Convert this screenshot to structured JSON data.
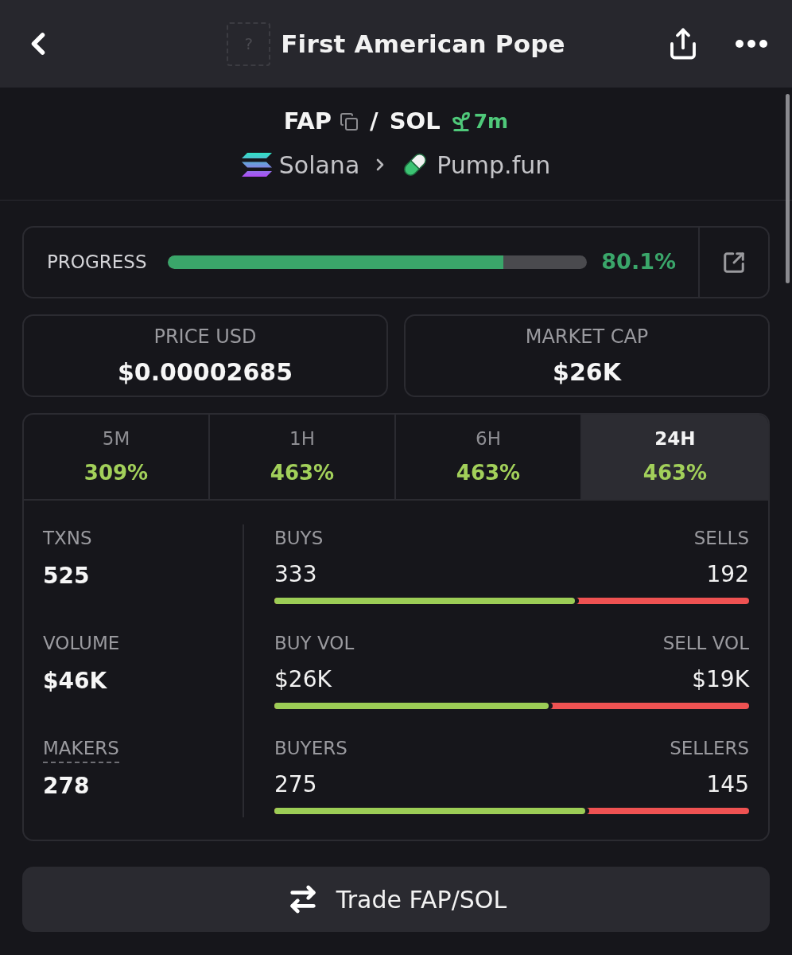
{
  "header": {
    "token_placeholder": "?",
    "title": "First American Pope"
  },
  "pair": {
    "base": "FAP",
    "separator": "/",
    "quote": "SOL",
    "age": "7m"
  },
  "breadcrumb": [
    {
      "kind": "chain",
      "label": "Solana"
    },
    {
      "kind": "dex",
      "label": "Pump.fun"
    }
  ],
  "progress": {
    "label": "PROGRESS",
    "level": 0.801,
    "value": "80.1%"
  },
  "price_cards": [
    {
      "label": "PRICE USD",
      "value": "$0.00002685"
    },
    {
      "label": "MARKET CAP",
      "value": "$26K"
    }
  ],
  "timeframes": [
    {
      "label": "5M",
      "change": "309%",
      "selected": false
    },
    {
      "label": "1H",
      "change": "463%",
      "selected": false
    },
    {
      "label": "6H",
      "change": "463%",
      "selected": false
    },
    {
      "label": "24H",
      "change": "463%",
      "selected": true
    }
  ],
  "summary": [
    {
      "label": "TXNS",
      "value": "525",
      "underlined": false
    },
    {
      "label": "VOLUME",
      "value": "$46K",
      "underlined": false
    },
    {
      "label": "MAKERS",
      "value": "278",
      "underlined": true
    }
  ],
  "splits": [
    {
      "left_label": "BUYS",
      "left_value": "333",
      "right_label": "SELLS",
      "right_value": "192",
      "level": 0.634
    },
    {
      "left_label": "BUY VOL",
      "left_value": "$26K",
      "right_label": "SELL VOL",
      "right_value": "$19K",
      "level": 0.578
    },
    {
      "left_label": "BUYERS",
      "left_value": "275",
      "right_label": "SELLERS",
      "right_value": "145",
      "level": 0.655
    }
  ],
  "trade_button": {
    "label": "Trade FAP/SOL"
  }
}
